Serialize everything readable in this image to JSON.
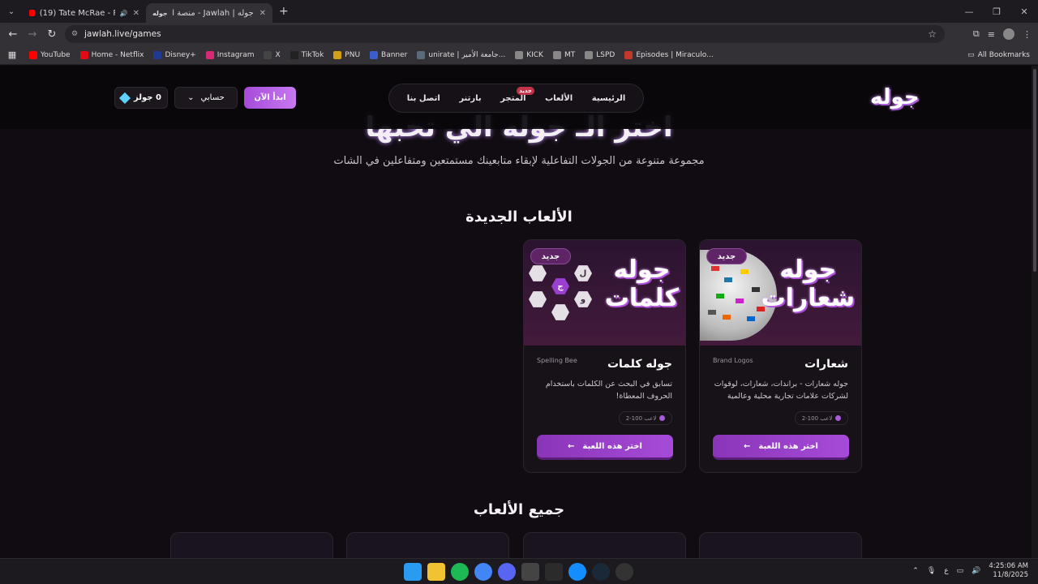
{
  "browser": {
    "tabs": [
      {
        "title": "(19) Tate McRae - Purple La",
        "audio": "🔊"
      },
      {
        "title": "جوله | Jawlah - منصة الألعاب الت",
        "active": true
      }
    ],
    "url": "jawlah.live/games",
    "bookmarks": [
      {
        "label": "YouTube",
        "color": "#ff0000"
      },
      {
        "label": "Home - Netflix",
        "color": "#e50914"
      },
      {
        "label": "Disney+",
        "color": "#1f3a93"
      },
      {
        "label": "Instagram",
        "color": "#d62976"
      },
      {
        "label": "X",
        "color": "#444444"
      },
      {
        "label": "TikTok",
        "color": "#222222"
      },
      {
        "label": "PNU",
        "color": "#d4a017"
      },
      {
        "label": "Banner",
        "color": "#3a5fcd"
      },
      {
        "label": "unirate | جامعة الأمير...",
        "color": "#5a6a7a"
      },
      {
        "label": "KICK",
        "color": "#888888"
      },
      {
        "label": "MT",
        "color": "#888888"
      },
      {
        "label": "LSPD",
        "color": "#888888"
      },
      {
        "label": "Episodes | Miraculo...",
        "color": "#c0392b"
      }
    ],
    "all_bookmarks": "All Bookmarks"
  },
  "header": {
    "logo": "جوله",
    "nav": [
      {
        "label": "الرئيسية"
      },
      {
        "label": "الألعاب"
      },
      {
        "label": "المتجر",
        "badge": "جديد"
      },
      {
        "label": "بارتنر"
      },
      {
        "label": "اتصل بنا"
      }
    ],
    "start_button": "ابدأ الآن",
    "account_button": "حسابي",
    "coins": "0 جولز"
  },
  "hero": {
    "title": "اختر الـ جوله الي تحبها",
    "subtitle": "مجموعة متنوعة من الجولات التفاعلية لإبقاء متابعينك مستمتعين ومتفاعلين في الشات"
  },
  "new_games": {
    "title": "الألعاب الجديدة",
    "cards": [
      {
        "badge": "جديد",
        "thumb_title_1": "جوله",
        "thumb_title_2": "شعارات",
        "name": "شعارات",
        "en_name": "Brand Logos",
        "desc": "جوله شعارات - براندات، شعارات، لوقوات لشركات علامات تجارية محلية وعالمية",
        "players": "2-100 لاعب",
        "button": "اختر هذه اللعبة"
      },
      {
        "badge": "جديد",
        "thumb_title_1": "جوله",
        "thumb_title_2": "كلمات",
        "name": "جوله كلمات",
        "en_name": "Spelling Bee",
        "desc": "تسابق في البحث عن الكلمات باستخدام الحروف المعطاة!",
        "players": "2-100 لاعب",
        "button": "اختر هذه اللعبة",
        "letters": [
          "ل",
          "ج",
          "و",
          "ة"
        ]
      }
    ]
  },
  "all_games": {
    "title": "جميع الألعاب"
  },
  "taskbar": {
    "time": "4:25:06 AM",
    "date": "11/8/2025",
    "lang": "ع"
  }
}
